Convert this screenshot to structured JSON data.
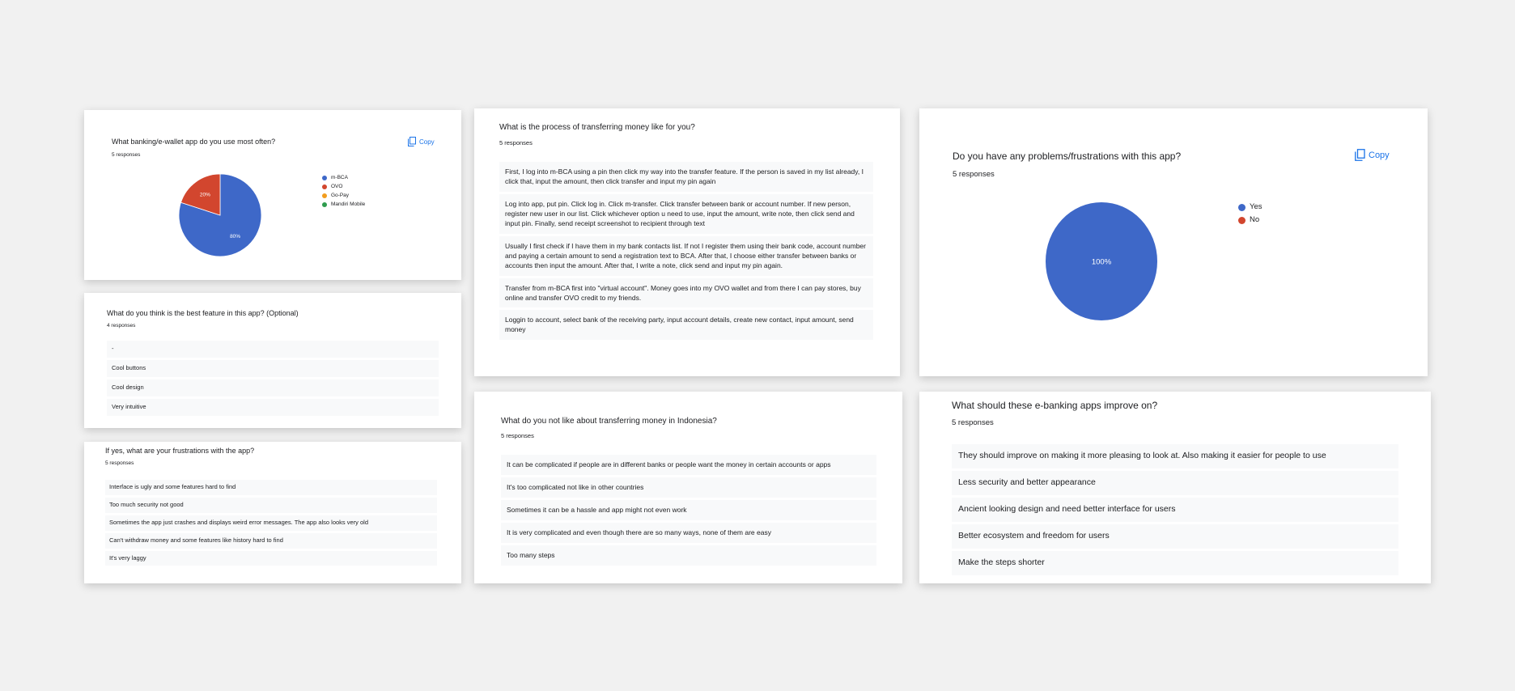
{
  "colors": {
    "blue": "#3e68c8",
    "red": "#d2462e",
    "orange": "#f29d1e",
    "green": "#2f9c4e",
    "accent": "#1a73e8"
  },
  "card1": {
    "question": "What banking/e-wallet app do you use most often?",
    "responses": "5 responses",
    "copy_label": "Copy",
    "legend": [
      "m-BCA",
      "OVO",
      "Go-Pay",
      "Mandiri Mobile"
    ],
    "chart_data": {
      "type": "pie",
      "categories": [
        "m-BCA",
        "OVO",
        "Go-Pay",
        "Mandiri Mobile"
      ],
      "values": [
        80,
        20,
        0,
        0
      ],
      "labels": [
        "80%",
        "20%"
      ],
      "colors": [
        "#3e68c8",
        "#d2462e",
        "#f29d1e",
        "#2f9c4e"
      ]
    }
  },
  "card2": {
    "question": "What do you think is the best feature in this app? (Optional)",
    "responses": "4 responses",
    "items": [
      "-",
      "Cool buttons",
      "Cool design",
      "Very intuitive"
    ]
  },
  "card3": {
    "question": "If yes, what are your frustrations with the app?",
    "responses": "5 responses",
    "items": [
      "Interface is ugly and some features hard to find",
      "Too much security not good",
      "Sometimes the app just crashes and displays weird error messages. The app also looks very old",
      "Can't withdraw money and some features like history hard to find",
      "It's very laggy"
    ]
  },
  "card4": {
    "question": "What is the process of transferring money like for you?",
    "responses": "5 responses",
    "items": [
      "First, I log into m-BCA using a pin then click my way into the transfer feature. If the person is saved in my list already, I click that, input the amount, then click transfer and input my pin again",
      "Log into app, put pin. Click log in. Click m-transfer. Click transfer between bank or account number. If new person, register new user in our list. Click whichever option u need to use, input the amount, write note, then click send and input pin. Finally, send receipt screenshot to recipient through text",
      "Usually I first check if I have them in my bank contacts list. If not I register them using their bank code, account number and paying a certain amount to send a registration text to BCA. After that, I choose either transfer between banks or accounts then input the amount. After that, I write a note, click send and input my pin again.",
      "Transfer from m-BCA first into \"virtual account\". Money goes into my OVO wallet and from there I can pay stores, buy online and transfer OVO credit to my friends.",
      "Loggin to account, select bank of the receiving party, input account details, create new contact, input amount, send money"
    ]
  },
  "card5": {
    "question": "What do you not like about transferring money in Indonesia?",
    "responses": "5 responses",
    "items": [
      "It can be complicated if people are in different banks or people want the money in certain accounts or apps",
      "It's too complicated not like in other countries",
      "Sometimes it can be a hassle and app might not even work",
      "It is very complicated and even though there are so many ways, none of them are easy",
      "Too many steps"
    ]
  },
  "card6": {
    "question": "Do you have any problems/frustrations with this app?",
    "responses": "5 responses",
    "copy_label": "Copy",
    "legend": [
      "Yes",
      "No"
    ],
    "chart_data": {
      "type": "pie",
      "categories": [
        "Yes",
        "No"
      ],
      "values": [
        100,
        0
      ],
      "labels": [
        "100%"
      ],
      "colors": [
        "#3e68c8",
        "#d2462e"
      ]
    }
  },
  "card7": {
    "question": "What should these e-banking apps improve on?",
    "responses": "5 responses",
    "items": [
      "They should improve on making it more pleasing to look at. Also making it easier for people to use",
      "Less security and better appearance",
      "Ancient looking design and need better interface for users",
      "Better ecosystem and freedom for users",
      "Make the steps shorter"
    ]
  }
}
